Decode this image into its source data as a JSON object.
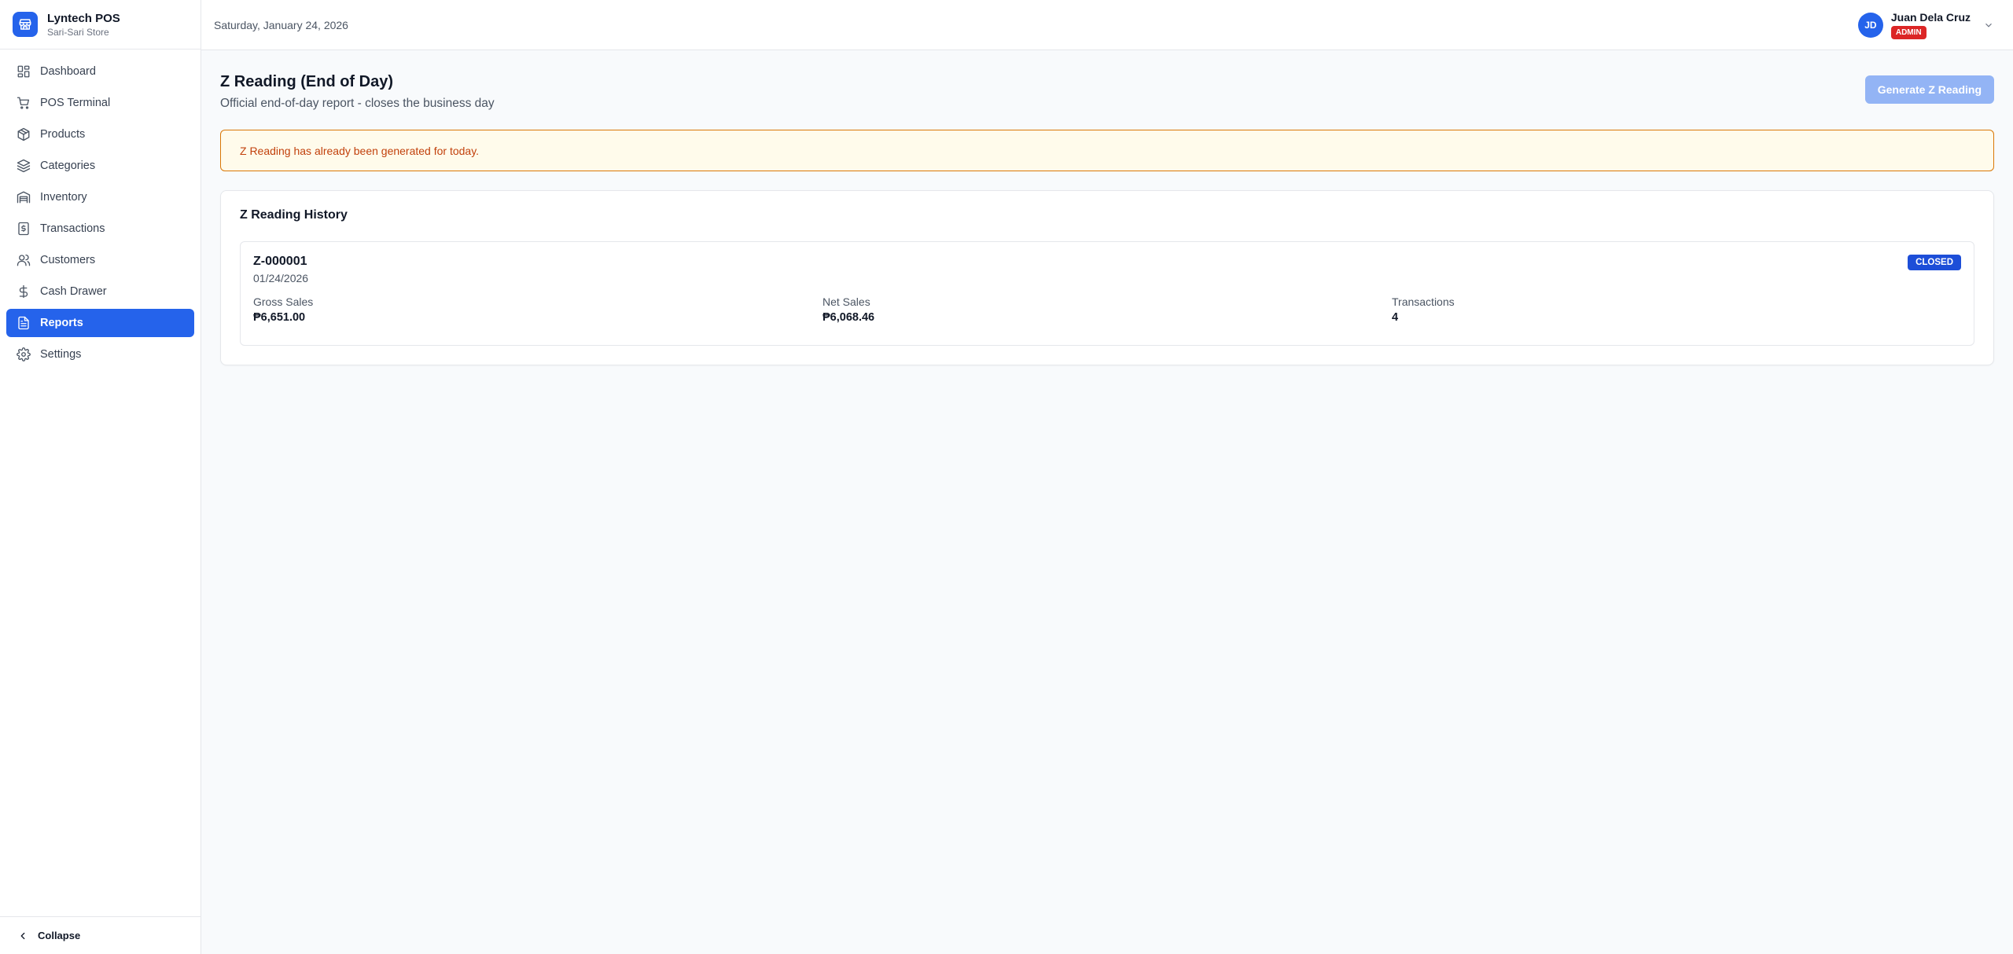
{
  "brand": {
    "name": "Lyntech POS",
    "subtitle": "Sari-Sari Store",
    "accent": "#2563eb"
  },
  "sidebar": {
    "items": [
      {
        "label": "Dashboard",
        "icon": "dashboard-icon",
        "active": false
      },
      {
        "label": "POS Terminal",
        "icon": "cart-icon",
        "active": false
      },
      {
        "label": "Products",
        "icon": "box-icon",
        "active": false
      },
      {
        "label": "Categories",
        "icon": "layers-icon",
        "active": false
      },
      {
        "label": "Inventory",
        "icon": "warehouse-icon",
        "active": false
      },
      {
        "label": "Transactions",
        "icon": "receipt-icon",
        "active": false
      },
      {
        "label": "Customers",
        "icon": "users-icon",
        "active": false
      },
      {
        "label": "Cash Drawer",
        "icon": "dollar-icon",
        "active": false
      },
      {
        "label": "Reports",
        "icon": "file-report-icon",
        "active": true
      },
      {
        "label": "Settings",
        "icon": "gear-icon",
        "active": false
      }
    ],
    "collapse_label": "Collapse"
  },
  "header": {
    "date": "Saturday, January 24, 2026",
    "user": {
      "initials": "JD",
      "name": "Juan Dela Cruz",
      "role": "ADMIN"
    }
  },
  "page": {
    "title": "Z Reading (End of Day)",
    "subtitle": "Official end-of-day report - closes the business day",
    "generate_button": "Generate Z Reading",
    "generate_disabled": true,
    "alert": "Z Reading has already been generated for today."
  },
  "history": {
    "title": "Z Reading History",
    "readings": [
      {
        "id": "Z-000001",
        "date": "01/24/2026",
        "status": "CLOSED",
        "gross_label": "Gross Sales",
        "gross_value": "₱6,651.00",
        "net_label": "Net Sales",
        "net_value": "₱6,068.46",
        "txn_label": "Transactions",
        "txn_value": "4"
      }
    ]
  }
}
